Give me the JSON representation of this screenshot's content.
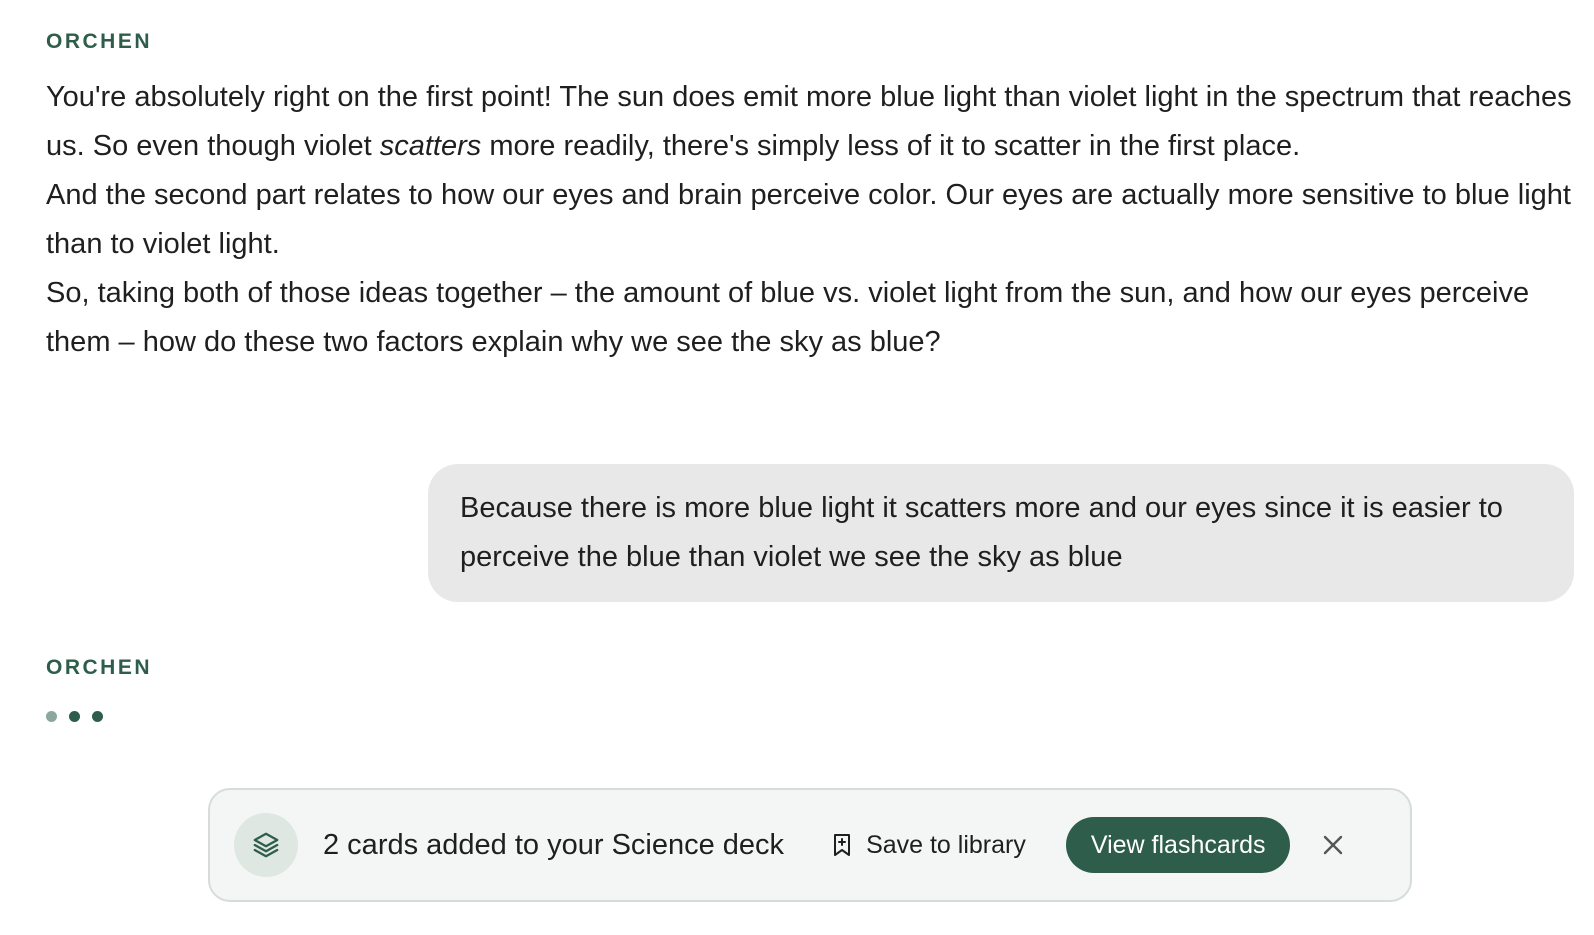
{
  "messages": [
    {
      "role": "assistant",
      "sender": "ORCHEN",
      "paragraphs": [
        {
          "before_italic": "You're absolutely right on the first point! The sun does emit more blue light than violet light in the spectrum that reaches us. So even though violet ",
          "italic": "scatters",
          "after_italic": " more readily, there's simply less of it to scatter in the first place."
        },
        {
          "text": "And the second part relates to how our eyes and brain perceive color. Our eyes are actually more sensitive to blue light than to violet light."
        },
        {
          "text": "So, taking both of those ideas together – the amount of blue vs. violet light from the sun, and how our eyes perceive them – how do these two factors explain why we see the sky as blue?"
        }
      ]
    },
    {
      "role": "user",
      "text": "Because there is more blue light it scatters more and our eyes since it is easier to perceive the blue than violet we see the sky as blue"
    },
    {
      "role": "assistant",
      "sender": "ORCHEN",
      "status": "typing"
    }
  ],
  "toast": {
    "icon": "layers-icon",
    "message": "2 cards added to your Science deck",
    "save_label": "Save to library",
    "save_icon": "bookmark-plus-icon",
    "view_label": "View flashcards",
    "close_icon": "close-icon"
  },
  "colors": {
    "accent": "#2e5e4b",
    "user_bubble": "#e8e8e8",
    "toast_bg": "#f3f6f4",
    "toast_border": "#d6ddd9",
    "icon_circle": "#dfe7e2",
    "text": "#1f1f1f"
  }
}
